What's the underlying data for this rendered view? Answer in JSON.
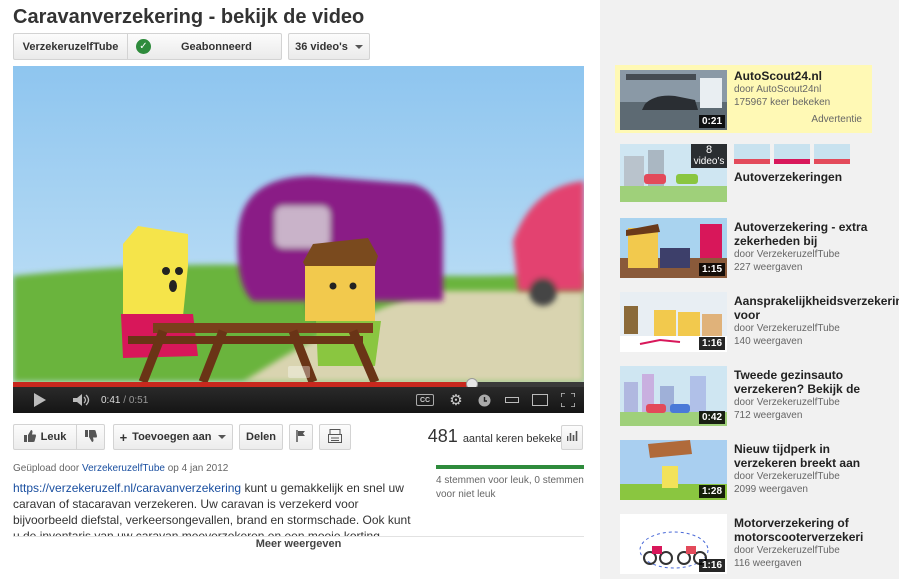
{
  "page": {
    "title": "Caravanverzekering - bekijk de video"
  },
  "channel": {
    "name": "VerzekeruzelfTube",
    "subscribed_label": "Geabonneerd",
    "videos_label": "36 video's"
  },
  "player": {
    "current_time": "0:41",
    "duration": "0:51",
    "progress_fraction": 0.804,
    "buffered_fraction": 1.0
  },
  "actions": {
    "like_label": "Leuk",
    "add_label": "Toevoegen aan",
    "share_label": "Delen"
  },
  "views": {
    "count": "481",
    "label": "aantal keren bekeken"
  },
  "upload": {
    "prefix": "Geüpload door",
    "uploader": "VerzekeruzelfTube",
    "date_text": "op 4 jan 2012"
  },
  "description": {
    "link": "https://verzekeruzelf.nl/caravanverzekering",
    "text": " kunt u gemakkelijk en snel uw caravan of stacaravan verzekeren. Uw caravan is verzekerd voor bijvoorbeeld diefstal, verkeersongevallen, brand en stormschade. Ook kunt u de inventaris van uw caravan meeverzekeren en een mooie korting ontvangen bij het afsluiten van uw verzekering."
  },
  "ratings": {
    "text": "4 stemmen voor leuk, 0 stemmen voor niet leuk",
    "like_fraction": 1.0
  },
  "more_label": "Meer weergeven",
  "sidebar": {
    "ad": {
      "title": "AutoScout24.nl",
      "by": "door AutoScout24nl",
      "count": "175967 keer bekeken",
      "label": "Advertentie",
      "duration": "0:21"
    },
    "playlist": {
      "title": "Autoverzekeringen",
      "count_number": "8",
      "count_label": "video's"
    },
    "items": [
      {
        "title": "Autoverzekering - extra zekerheden bij",
        "by": "door VerzekeruzelfTube",
        "count": "227 weergaven",
        "duration": "1:15"
      },
      {
        "title": "Aansprakelijkheidsverzekering voor",
        "by": "door VerzekeruzelfTube",
        "count": "140 weergaven",
        "duration": "1:16"
      },
      {
        "title": "Tweede gezinsauto verzekeren? Bekijk de",
        "by": "door VerzekeruzelfTube",
        "count": "712 weergaven",
        "duration": "0:42"
      },
      {
        "title": "Nieuw tijdperk in verzekeren breekt aan",
        "by": "door VerzekeruzelfTube",
        "count": "2099 weergaven",
        "duration": "1:28"
      },
      {
        "title": "Motorverzekering of motorscooterverzekeri",
        "by": "door VerzekeruzelfTube",
        "count": "116 weergaven",
        "duration": "1:16"
      }
    ]
  },
  "colors": {
    "progress": "#c8281e",
    "like_bar": "#2e8b3c",
    "link": "#1a4fa0",
    "ad_background": "#fff9b5"
  }
}
